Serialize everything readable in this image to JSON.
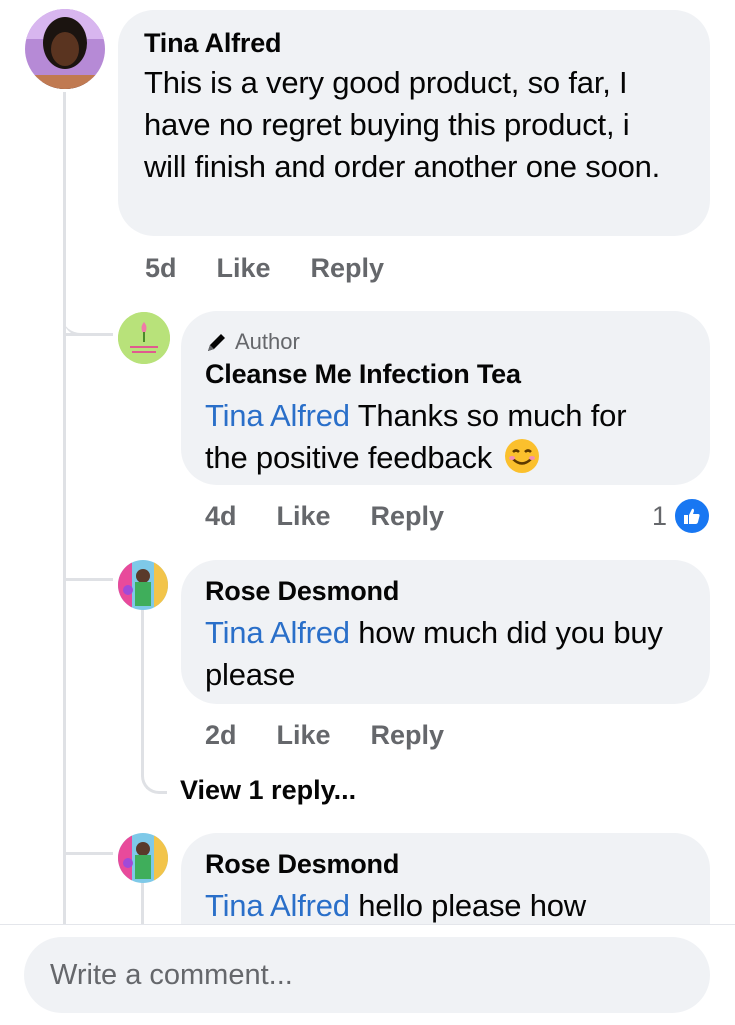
{
  "comments": [
    {
      "author": "Tina Alfred",
      "text": "This is a very good product, so far, I have no regret buying this product, i will finish and order another one soon.",
      "time": "5d",
      "like_label": "Like",
      "reply_label": "Reply"
    },
    {
      "author_badge": "Author",
      "author": "Cleanse Me Infection Tea",
      "mention": "Tina Alfred",
      "text": " Thanks so much for the positive feedback",
      "time": "4d",
      "like_label": "Like",
      "reply_label": "Reply",
      "reaction_count": "1"
    },
    {
      "author": "Rose Desmond",
      "mention": "Tina Alfred",
      "text": " how much did you buy please",
      "time": "2d",
      "like_label": "Like",
      "reply_label": "Reply",
      "view_replies": "View 1 reply..."
    },
    {
      "author": "Rose Desmond",
      "mention": "Tina Alfred",
      "text": " hello please how"
    }
  ],
  "composer": {
    "placeholder": "Write a comment..."
  },
  "colors": {
    "bubble": "#f0f2f5",
    "mention": "#2a6fc9",
    "like_blue": "#1877f2",
    "muted": "#65676b"
  }
}
